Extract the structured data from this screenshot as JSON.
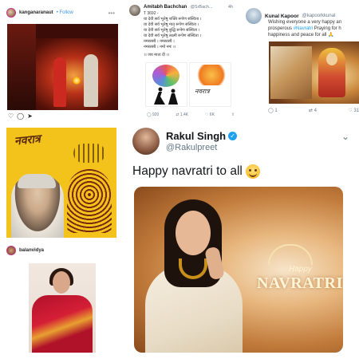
{
  "kangana_post": {
    "username": "kanganaranaut",
    "follow": "• Follow"
  },
  "amitabh_tweet": {
    "name": "Amitabh Bachchan",
    "handle": "@SrBach...",
    "time": "4h",
    "tweet_id": "T 3692 -",
    "lines": [
      "या देवी सर्व भूतेषु शक्ति रूपेण संस्थिता ।",
      "या देवी सर्व भूतेषु मातृ रूपेण संस्थिता ।",
      "या देवी सर्व भूतेषु बुद्धि रूपेण संस्थिता ।",
      "या देवी सर्व भूतेषु लक्ष्मी रूपेण संस्थिता ।",
      "नमस्तस्यै । नमस्तस्यै ।",
      "नमस्तस्यै । नमो नमः ।।"
    ],
    "closing": "।। जय माता दी ।।",
    "image_word": "नवरात्र",
    "counts": {
      "replies": "920",
      "retweets": "1.4K",
      "likes": "6K"
    }
  },
  "kunal_tweet": {
    "name": "Kunal Kapoor",
    "handle": "@kapoorkkunal",
    "text_before": "Wishing everyone a very happy an",
    "text_line2_before": "prosperous ",
    "hashtag": "#Navratri",
    "text_line2_after": " Praying for h",
    "text_line3": "happiness and peace for all 🙏",
    "counts": {
      "replies": "1",
      "retweets": "4",
      "likes": "31"
    }
  },
  "navratri_card": {
    "title": "नवरात्र"
  },
  "vidya_post": {
    "username": "balanvidya"
  },
  "rakul_tweet": {
    "name": "Rakul Singh",
    "handle": "@Rakulpreet",
    "text": "Happy navratri to all",
    "image_happy": "Happy",
    "image_navratri": "NAVRATRI"
  },
  "colors": {
    "twitter_blue": "#1da1f2",
    "instagram_follow": "#3897f0",
    "card_yellow": "#f4c31b",
    "muted": "#657786"
  },
  "icons": [
    "more-icon",
    "heart-icon",
    "comment-icon",
    "share-icon",
    "reply-icon",
    "retweet-icon",
    "like-icon",
    "verified-icon",
    "chevron-down-icon"
  ]
}
